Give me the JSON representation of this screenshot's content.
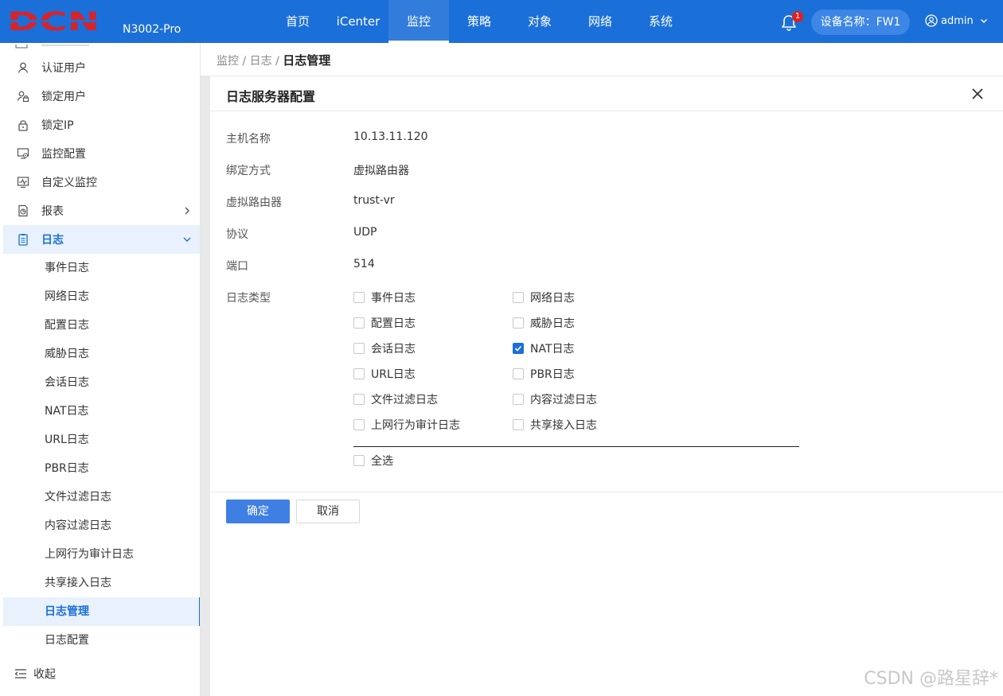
{
  "header": {
    "logo_text": "DCN",
    "model": "N3002-Pro",
    "nav": [
      "首页",
      "iCenter",
      "监控",
      "策略",
      "对象",
      "网络",
      "系统"
    ],
    "active_nav": "监控",
    "notification_count": "1",
    "device_label": "设备名称：FW1",
    "user": "admin"
  },
  "sidebar": {
    "items": [
      {
        "label": "认证用户",
        "icon": "user-icon"
      },
      {
        "label": "锁定用户",
        "icon": "lock-user-icon"
      },
      {
        "label": "锁定IP",
        "icon": "lock-icon"
      },
      {
        "label": "监控配置",
        "icon": "monitor-settings-icon"
      },
      {
        "label": "自定义监控",
        "icon": "custom-monitor-icon"
      },
      {
        "label": "报表",
        "icon": "report-icon"
      },
      {
        "label": "日志",
        "icon": "log-icon"
      }
    ],
    "log_subitems": [
      "事件日志",
      "网络日志",
      "配置日志",
      "威胁日志",
      "会话日志",
      "NAT日志",
      "URL日志",
      "PBR日志",
      "文件过滤日志",
      "内容过滤日志",
      "上网行为审计日志",
      "共享接入日志",
      "日志管理",
      "日志配置"
    ],
    "active_sub": "日志管理",
    "collapse_label": "收起"
  },
  "breadcrumb": {
    "parts": [
      "监控",
      "日志"
    ],
    "sep": " / ",
    "current": "日志管理"
  },
  "dialog": {
    "title": "日志服务器配置",
    "fields": [
      {
        "label": "主机名称",
        "value": "10.13.11.120"
      },
      {
        "label": "绑定方式",
        "value": "虚拟路由器"
      },
      {
        "label": "虚拟路由器",
        "value": "trust-vr"
      },
      {
        "label": "协议",
        "value": "UDP"
      },
      {
        "label": "端口",
        "value": "514"
      }
    ],
    "log_type_label": "日志类型",
    "log_types": [
      {
        "label": "事件日志",
        "checked": false
      },
      {
        "label": "网络日志",
        "checked": false
      },
      {
        "label": "配置日志",
        "checked": false
      },
      {
        "label": "威胁日志",
        "checked": false
      },
      {
        "label": "会话日志",
        "checked": false
      },
      {
        "label": "NAT日志",
        "checked": true
      },
      {
        "label": "URL日志",
        "checked": false
      },
      {
        "label": "PBR日志",
        "checked": false
      },
      {
        "label": "文件过滤日志",
        "checked": false
      },
      {
        "label": "内容过滤日志",
        "checked": false
      },
      {
        "label": "上网行为审计日志",
        "checked": false
      },
      {
        "label": "共享接入日志",
        "checked": false
      }
    ],
    "select_all": {
      "label": "全选",
      "checked": false
    },
    "ok_label": "确定",
    "cancel_label": "取消"
  },
  "watermark": "CSDN @路星辞*",
  "colors": {
    "brand": "#1b6fd8",
    "logo_red": "#d9232a",
    "active_bg": "#e8f1fc"
  }
}
